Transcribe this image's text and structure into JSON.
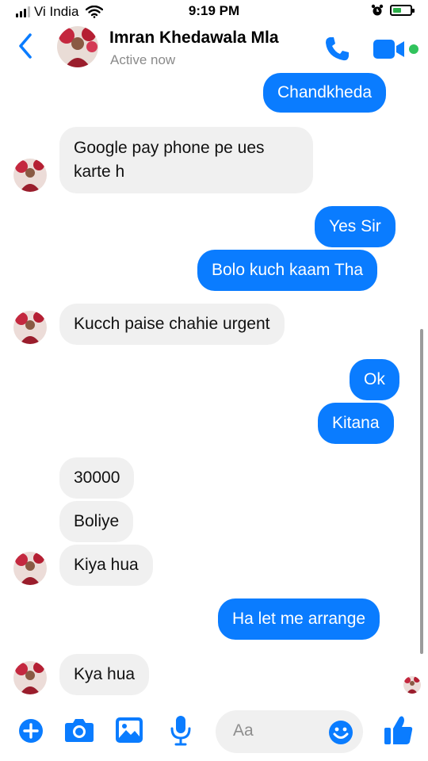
{
  "status_bar": {
    "carrier": "Vi India",
    "time": "9:19 PM"
  },
  "header": {
    "contact_name": "Imran Khedawala Mla",
    "presence": "Active now"
  },
  "messages": [
    {
      "side": "out",
      "text": "Chandkheda"
    },
    {
      "side": "in",
      "text": "Google pay phone pe ues karte h"
    },
    {
      "side": "out",
      "text": "Yes Sir"
    },
    {
      "side": "out",
      "text": "Bolo kuch kaam Tha"
    },
    {
      "side": "in",
      "text": "Kucch paise chahie urgent"
    },
    {
      "side": "out",
      "text": "Ok"
    },
    {
      "side": "out",
      "text": "Kitana"
    },
    {
      "side": "in",
      "text": "30000"
    },
    {
      "side": "in",
      "text": "Boliye"
    },
    {
      "side": "in",
      "text": "Kiya hua"
    },
    {
      "side": "out",
      "text": "Ha let me arrange"
    },
    {
      "side": "in",
      "text": "Kya hua"
    }
  ],
  "composer": {
    "placeholder": "Aa",
    "icons": [
      "plus-icon",
      "camera-icon",
      "photo-icon",
      "microphone-icon",
      "emoji-icon",
      "thumbs-up-icon"
    ]
  },
  "colors": {
    "accent": "#0a7cff",
    "incoming_bubble": "#f0f0f0",
    "online": "#31c35c"
  }
}
